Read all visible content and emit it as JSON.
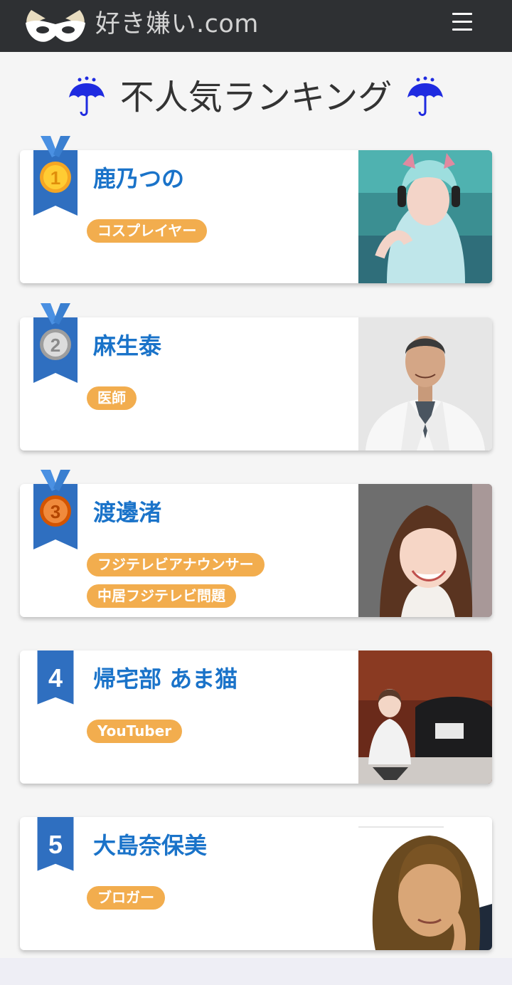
{
  "header": {
    "site_name": "好き嫌い.com",
    "logo_icon": "mask-logo-icon",
    "menu_icon": "hamburger-menu-icon"
  },
  "page": {
    "title": "不人気ランキング",
    "title_icon": "umbrella-rain-icon"
  },
  "colors": {
    "header_bg": "#2e3033",
    "name_blue": "#1a73c9",
    "ribbon_blue": "#2f6fc0",
    "tag_orange": "#f2ad4e"
  },
  "ranking": [
    {
      "rank": "1",
      "medal": "gold-medal-icon",
      "name": "鹿乃つの",
      "tags": [
        "コスプレイヤー"
      ]
    },
    {
      "rank": "2",
      "medal": "silver-medal-icon",
      "name": "麻生泰",
      "tags": [
        "医師"
      ]
    },
    {
      "rank": "3",
      "medal": "bronze-medal-icon",
      "name": "渡邊渚",
      "tags": [
        "フジテレビアナウンサー",
        "中居フジテレビ問題"
      ]
    },
    {
      "rank": "4",
      "medal": "",
      "name": "帰宅部 あま猫",
      "tags": [
        "YouTuber"
      ]
    },
    {
      "rank": "5",
      "medal": "",
      "name": "大島奈保美",
      "tags": [
        "ブロガー"
      ]
    }
  ]
}
